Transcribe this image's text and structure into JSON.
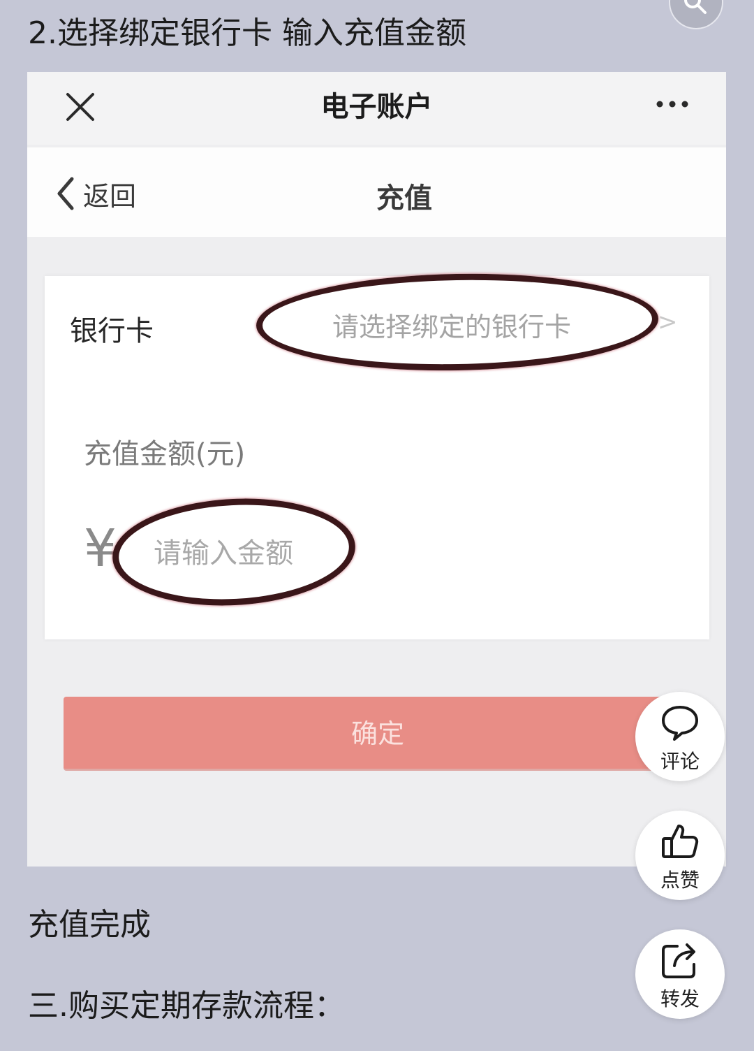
{
  "post": {
    "step_heading": "2.选择绑定银行卡 输入充值金额",
    "completion_text": "充值完成",
    "section_heading": "三.购买定期存款流程："
  },
  "screenshot": {
    "nav": {
      "title": "电子账户",
      "close_icon": "close-icon",
      "more_icon": "more-icon"
    },
    "sub_header": {
      "back_label": "返回",
      "title": "充值"
    },
    "form": {
      "bank_label": "银行卡",
      "bank_placeholder": "请选择绑定的银行卡",
      "bank_chevron": ">",
      "amount_label": "充值金额(元)",
      "currency_symbol": "¥",
      "amount_placeholder": "请输入金额"
    },
    "confirm_label": "确定"
  },
  "actions": [
    {
      "label": "评论",
      "icon": "comment-icon"
    },
    {
      "label": "点赞",
      "icon": "thumbs-up-icon"
    },
    {
      "label": "转发",
      "icon": "share-icon"
    }
  ],
  "colors": {
    "page_background": "#c5c7d6",
    "confirm_button": "#e88d86",
    "annotation_stroke": "#3a1619"
  }
}
